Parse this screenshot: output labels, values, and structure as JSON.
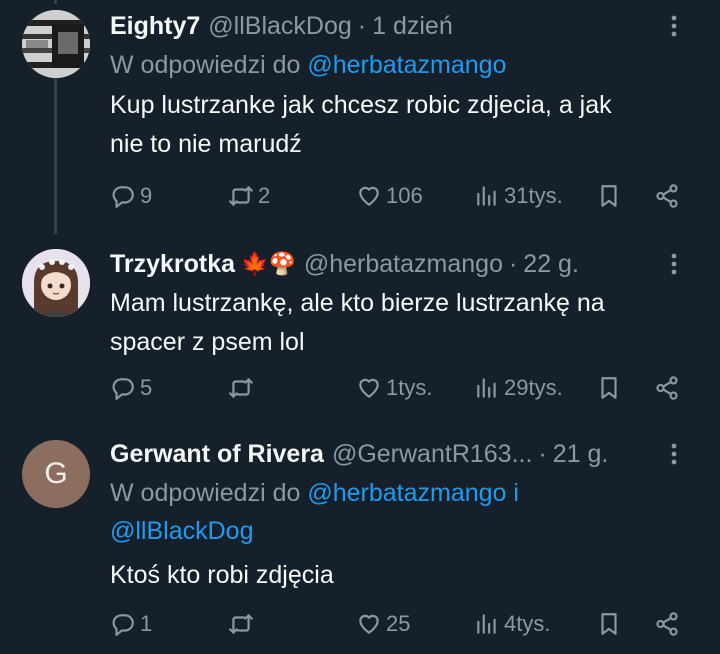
{
  "tweets": [
    {
      "name": "Eighty7",
      "handle": "@llBlackDog",
      "time": "1 dzień",
      "reply_prefix": "W odpowiedzi do",
      "reply_mentions": "@herbatazmango",
      "reply_mentions2": "",
      "text_line1": "Kup lustrzanke jak chcesz robic zdjecia, a jak",
      "text_line2": "nie to nie marudź",
      "replies": "9",
      "retweets": "2",
      "likes": "106",
      "views": "31tys.",
      "avatar": "grayscale-dog-avatar"
    },
    {
      "name": "Trzykrotka",
      "emojis": "🍁🍄",
      "handle": "@herbatazmango",
      "time": "22 g.",
      "text_line1": "Mam lustrzankę, ale kto bierze lustrzankę na",
      "text_line2": "spacer z psem lol",
      "replies": "5",
      "retweets": "",
      "likes": "1tys.",
      "views": "29tys.",
      "avatar": "anime-girl-avatar"
    },
    {
      "name": "Gerwant of Rivera",
      "handle": "@GerwantR163...",
      "time": "21 g.",
      "reply_prefix": "W odpowiedzi do",
      "reply_mentions": "@herbatazmango i",
      "reply_mentions2": "@llBlackDog",
      "text_line1": "Ktoś kto robi zdjęcia",
      "replies": "1",
      "retweets": "",
      "likes": "25",
      "views": "4tys.",
      "avatar_letter": "G",
      "avatar_color": "#8c6e60"
    }
  ],
  "colors": {
    "background": "#15202b",
    "muted": "#8b98a5",
    "link": "#1d9bf0",
    "text": "#f7f9f9"
  }
}
